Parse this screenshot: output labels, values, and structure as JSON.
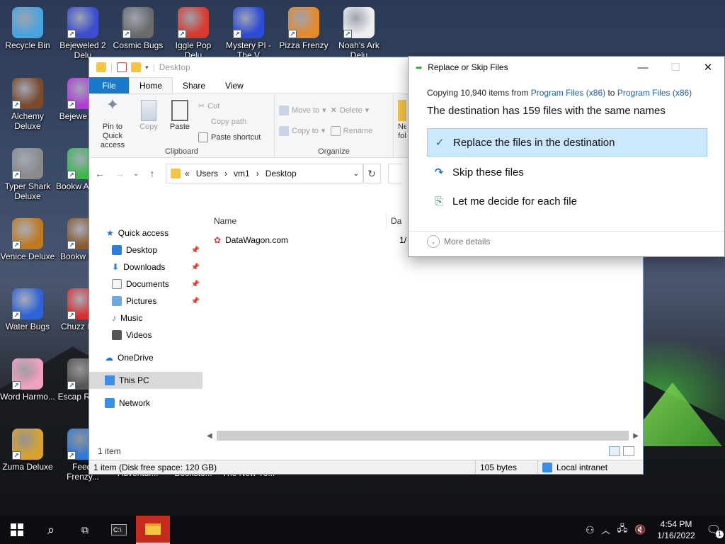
{
  "desktop": {
    "icons": [
      {
        "label": "Recycle Bin",
        "color": "#4aa3df"
      },
      {
        "label": "Bejeweled 2 Delu",
        "color": "#3b4ed1"
      },
      {
        "label": "Cosmic Bugs",
        "color": "#6b6b6b"
      },
      {
        "label": "Iggle Pop Delu",
        "color": "#d83a2e"
      },
      {
        "label": "Mystery PI - The V",
        "color": "#2e4bd8"
      },
      {
        "label": "Pizza Frenzy",
        "color": "#e58a2b"
      },
      {
        "label": "Noah's Ark Delu",
        "color": "#eeeeee"
      },
      {
        "label": "Alchemy Deluxe",
        "color": "#7a4a2a"
      },
      {
        "label": "Bejewe Twis",
        "color": "#b23bd8"
      },
      {
        "label": "Typer Shark Deluxe",
        "color": "#8a8a8a"
      },
      {
        "label": "Bookw Advent",
        "color": "#3bb84a"
      },
      {
        "label": "Venice Deluxe",
        "color": "#c07a1e"
      },
      {
        "label": "Bookw Delu",
        "color": "#8a5a2a"
      },
      {
        "label": "Water Bugs",
        "color": "#2e63d8"
      },
      {
        "label": "Chuzz Delu",
        "color": "#d8302e"
      },
      {
        "label": "Word Harmo...",
        "color": "#f0a0c0"
      },
      {
        "label": "Escap Rosec",
        "color": "#555555"
      },
      {
        "label": "Zuma Deluxe",
        "color": "#d8a22e"
      },
      {
        "label": "Feedi Frenzy...",
        "color": "#2e7ad8"
      },
      {
        "label": "Adventur...",
        "color": ""
      },
      {
        "label": "Booksto...",
        "color": ""
      },
      {
        "label": "The New Yo...",
        "color": ""
      }
    ]
  },
  "explorer": {
    "title": "Desktop",
    "tabs": {
      "file": "File",
      "home": "Home",
      "share": "Share",
      "view": "View"
    },
    "ribbon": {
      "pin": "Pin to Quick access",
      "copy": "Copy",
      "paste": "Paste",
      "cut": "Cut",
      "copy_path": "Copy path",
      "paste_shortcut": "Paste shortcut",
      "clipboard": "Clipboard",
      "move_to": "Move to",
      "copy_to": "Copy to",
      "delete": "Delete",
      "rename": "Rename",
      "organize": "Organize",
      "new_folder": "Ne fol"
    },
    "address": {
      "prefix": "«",
      "crumbs": [
        "Users",
        "vm1",
        "Desktop"
      ]
    },
    "nav": {
      "quick_access": "Quick access",
      "desktop": "Desktop",
      "downloads": "Downloads",
      "documents": "Documents",
      "pictures": "Pictures",
      "music": "Music",
      "videos": "Videos",
      "onedrive": "OneDrive",
      "this_pc": "This PC",
      "network": "Network"
    },
    "columns": {
      "name": "Name",
      "date": "Da"
    },
    "files": [
      {
        "name": "DataWagon.com",
        "date": "1/"
      }
    ],
    "status": {
      "count": "1 item"
    },
    "details_bar": {
      "summary": "1 item (Disk free space: 120 GB)",
      "size": "105 bytes",
      "zone": "Local intranet"
    }
  },
  "dialog": {
    "title": "Replace or Skip Files",
    "copying_prefix": "Copying 10,940 items from",
    "source": "Program Files (x86)",
    "to": "to",
    "dest": "Program Files (x86)",
    "headline": "The destination has 159 files with the same names",
    "options": {
      "replace": "Replace the files in the destination",
      "skip": "Skip these files",
      "decide": "Let me decide for each file"
    },
    "more_details": "More details"
  },
  "taskbar": {
    "time": "4:54 PM",
    "date": "1/16/2022",
    "notifications": "1"
  }
}
